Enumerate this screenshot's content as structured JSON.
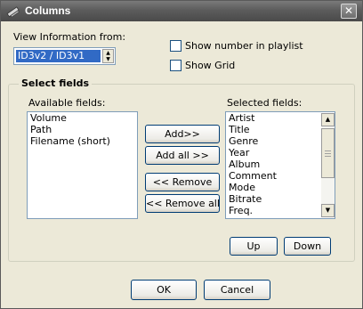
{
  "window": {
    "title": "Columns",
    "close_label": "✕"
  },
  "view_info": {
    "label": "View Information from:",
    "selected": "ID3v2 / ID3v1"
  },
  "options": {
    "show_number_label": "Show number in playlist",
    "show_number_checked": false,
    "show_grid_label": "Show Grid",
    "show_grid_checked": false
  },
  "select_fields": {
    "title": "Select fields",
    "available_label": "Available fields:",
    "available": [
      "Volume",
      "Path",
      "Filename (short)"
    ],
    "selected_label": "Selected fields:",
    "selected": [
      "Artist",
      "Title",
      "Genre",
      "Year",
      "Album",
      "Comment",
      "Mode",
      "Bitrate",
      "Freq."
    ]
  },
  "buttons": {
    "add": "Add>>",
    "add_all": "Add all >>",
    "remove": "<< Remove",
    "remove_all": "<< Remove all",
    "up": "Up",
    "down": "Down",
    "ok": "OK",
    "cancel": "Cancel"
  },
  "icons": {
    "app": "columns-app-icon",
    "close": "close-icon",
    "spin": "spin-updown-icon",
    "scroll_up": "scroll-up-arrow-icon",
    "scroll_down": "scroll-down-arrow-icon"
  },
  "colors": {
    "titlebar": "#5c5c5c",
    "dialog_bg": "#ece9d8",
    "selection": "#316ac5",
    "button_border": "#003c74",
    "input_border": "#7f9db9"
  }
}
